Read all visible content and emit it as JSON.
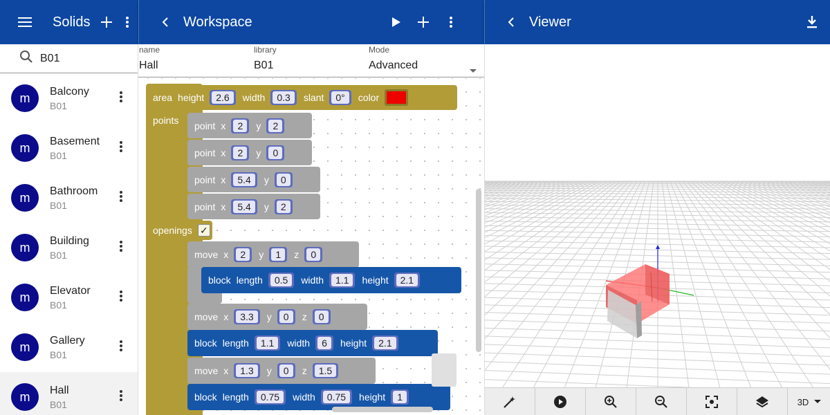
{
  "solids": {
    "title": "Solids",
    "search_value": "B01",
    "items": [
      {
        "avatar": "m",
        "name": "Balcony",
        "library": "B01"
      },
      {
        "avatar": "m",
        "name": "Basement",
        "library": "B01"
      },
      {
        "avatar": "m",
        "name": "Bathroom",
        "library": "B01"
      },
      {
        "avatar": "m",
        "name": "Building",
        "library": "B01"
      },
      {
        "avatar": "m",
        "name": "Elevator",
        "library": "B01"
      },
      {
        "avatar": "m",
        "name": "Gallery",
        "library": "B01"
      },
      {
        "avatar": "m",
        "name": "Hall",
        "library": "B01"
      }
    ]
  },
  "workspace": {
    "title": "Workspace",
    "fields": {
      "name_label": "name",
      "name_value": "Hall",
      "library_label": "library",
      "library_value": "B01",
      "mode_label": "Mode",
      "mode_value": "Advanced"
    },
    "blocks": {
      "area": {
        "kw": "area",
        "height_kw": "height",
        "height": "2.6",
        "width_kw": "width",
        "width": "0.3",
        "slant_kw": "slant",
        "slant": "0°",
        "color_kw": "color",
        "color": "#ee0000"
      },
      "points_kw": "points",
      "points": [
        {
          "kw": "point",
          "x": "2",
          "y": "2"
        },
        {
          "kw": "point",
          "x": "2",
          "y": "0"
        },
        {
          "kw": "point",
          "x": "5.4",
          "y": "0"
        },
        {
          "kw": "point",
          "x": "5.4",
          "y": "2"
        }
      ],
      "openings_kw": "openings",
      "openings_checked": "✓",
      "move1": {
        "kw": "move",
        "x": "2",
        "y": "1",
        "z": "0"
      },
      "block1": {
        "kw": "block",
        "length": "0.5",
        "width": "1.1",
        "height": "2.1"
      },
      "move2": {
        "kw": "move",
        "x": "3.3",
        "y": "0",
        "z": "0"
      },
      "block2": {
        "kw": "block",
        "length": "1.1",
        "width": "6",
        "height": "2.1"
      },
      "move3": {
        "kw": "move",
        "x": "1.3",
        "y": "0",
        "z": "1.5"
      },
      "block3": {
        "kw": "block",
        "length": "0.75",
        "width": "0.75",
        "height": "1"
      },
      "labels": {
        "x": "x",
        "y": "y",
        "z": "z",
        "length": "length",
        "width": "width",
        "height": "height"
      }
    }
  },
  "viewer": {
    "title": "Viewer",
    "dimension": "3D",
    "toolbar_icons": [
      "magic-wand-icon",
      "play-circle-icon",
      "zoom-in-icon",
      "zoom-out-icon",
      "center-focus-icon",
      "layers-icon"
    ]
  },
  "colors": {
    "appbar": "#0d47a1",
    "avatar": "#0b0b8c",
    "block_gold": "#b19c38",
    "block_grey": "#a6a6a6",
    "block_blue": "#1656a8",
    "solid_red": "#ee4444"
  }
}
